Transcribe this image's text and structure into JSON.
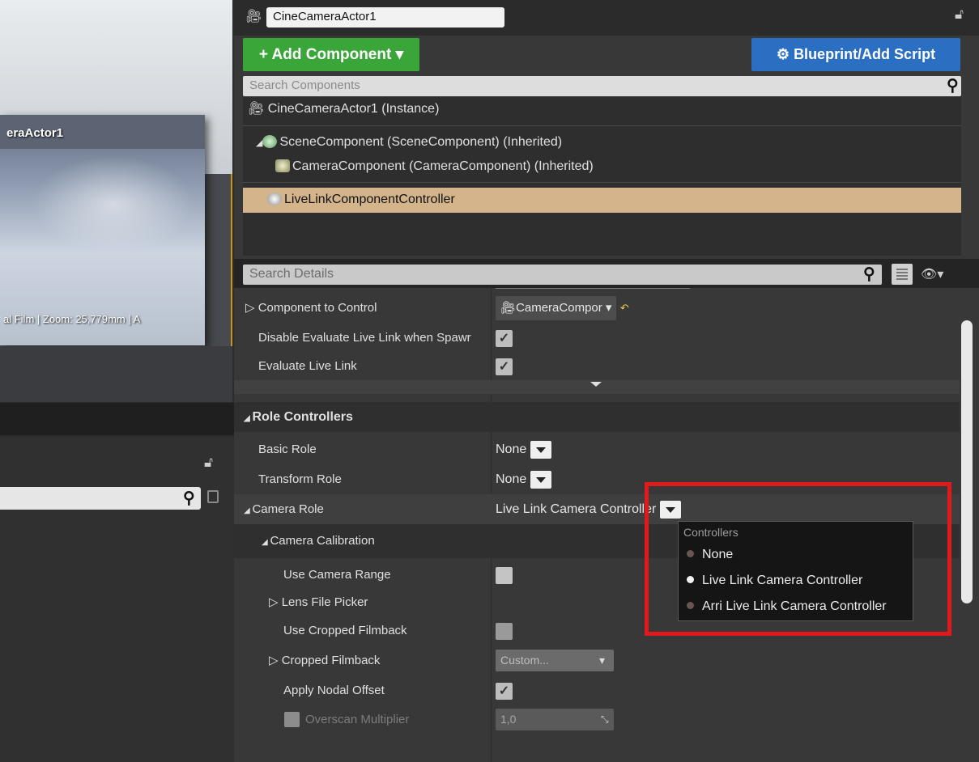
{
  "viewport": {
    "camera_label": "eraActor1",
    "info_text": "al Film | Zoom: 25,779mm | A"
  },
  "header": {
    "actor_name": "CineCameraActor1"
  },
  "toolbar": {
    "add_component_label": "+ Add Component ▾",
    "blueprint_label": "Blueprint/Add Script",
    "search_components_placeholder": "Search Components"
  },
  "component_tree": {
    "root": "CineCameraActor1 (Instance)",
    "items": [
      {
        "label": "SceneComponent (SceneComponent) (Inherited)"
      },
      {
        "label": "CameraComponent (CameraComponent) (Inherited)"
      },
      {
        "label": "LiveLinkComponentController"
      }
    ]
  },
  "details": {
    "search_placeholder": "Search Details",
    "rows": {
      "component_to_control": {
        "label": "Component to Control",
        "value": "CameraCompor"
      },
      "disable_evaluate": {
        "label": "Disable Evaluate Live Link when Spawr",
        "checked": true
      },
      "evaluate_live_link": {
        "label": "Evaluate Live Link",
        "checked": true
      },
      "role_controllers": {
        "label": "Role Controllers"
      },
      "basic_role": {
        "label": "Basic Role",
        "value": "None"
      },
      "transform_role": {
        "label": "Transform Role",
        "value": "None"
      },
      "camera_role": {
        "label": "Camera Role",
        "value": "Live Link Camera Controller"
      },
      "camera_calibration": {
        "label": "Camera Calibration"
      },
      "use_camera_range": {
        "label": "Use Camera Range",
        "checked": false
      },
      "lens_file_picker": {
        "label": "Lens File Picker"
      },
      "use_cropped_filmback": {
        "label": "Use Cropped Filmback",
        "checked": false
      },
      "cropped_filmback": {
        "label": "Cropped Filmback",
        "value": "Custom..."
      },
      "apply_nodal_offset": {
        "label": "Apply Nodal Offset",
        "checked": true
      },
      "overscan_multiplier": {
        "label": "Overscan Multiplier",
        "value": "1,0"
      }
    }
  },
  "controllers_menu": {
    "header": "Controllers",
    "items": [
      {
        "label": "None",
        "selected": false
      },
      {
        "label": "Live Link Camera Controller",
        "selected": true
      },
      {
        "label": "Arri Live Link Camera Controller",
        "selected": false
      }
    ]
  },
  "colors": {
    "add_component": "#3aa63a",
    "blueprint": "#2b6fc2",
    "selection": "#d4b48a",
    "highlight_box": "#e01a1a"
  }
}
